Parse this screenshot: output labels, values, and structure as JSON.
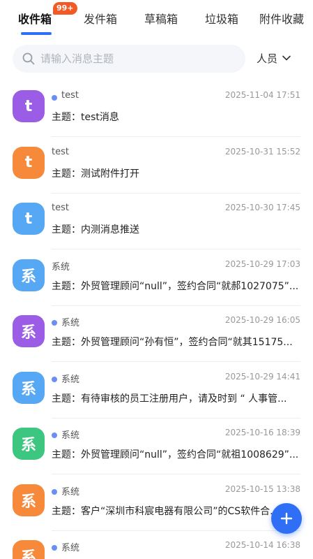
{
  "tabs": [
    {
      "label": "收件箱",
      "active": true
    },
    {
      "label": "发件箱",
      "active": false
    },
    {
      "label": "草稿箱",
      "active": false
    },
    {
      "label": "垃圾箱",
      "active": false
    },
    {
      "label": "附件收藏",
      "active": false
    }
  ],
  "badge": "99+",
  "search": {
    "placeholder": "请输入消息主题"
  },
  "filter": {
    "label": "人员"
  },
  "colors": {
    "accent": "#2f6ff5",
    "purple": "#9b5de5",
    "orange": "#f7893b",
    "blue": "#56a8f5",
    "green": "#3cc67f",
    "unread_dot": "#6a8ef7"
  },
  "messages": [
    {
      "avatar": "t",
      "color": "#9b5de5",
      "unread": true,
      "sender": "test",
      "time": "2025-11-04 17:51",
      "subject": "主题：test消息"
    },
    {
      "avatar": "t",
      "color": "#f7893b",
      "unread": false,
      "sender": "test",
      "time": "2025-10-31 15:52",
      "subject": "主题：测试附件打开"
    },
    {
      "avatar": "t",
      "color": "#56a8f5",
      "unread": false,
      "sender": "test",
      "time": "2025-10-30 17:45",
      "subject": "主题：内测消息推送"
    },
    {
      "avatar": "系",
      "color": "#56a8f5",
      "unread": false,
      "sender": "系统",
      "time": "2025-10-29 17:03",
      "subject": "主题：外贸管理顾问“null”，签约合同“就郝1027075”..."
    },
    {
      "avatar": "系",
      "color": "#9b5de5",
      "unread": true,
      "sender": "系统",
      "time": "2025-10-29 16:05",
      "subject": "主题：外贸管理顾问“孙有恒”，签约合同“就其15175..."
    },
    {
      "avatar": "系",
      "color": "#56a8f5",
      "unread": true,
      "sender": "系统",
      "time": "2025-10-29 14:41",
      "subject": "主题：有待审核的员工注册用户，请及时到 “ 人事管..."
    },
    {
      "avatar": "系",
      "color": "#3cc67f",
      "unread": true,
      "sender": "系统",
      "time": "2025-10-16 18:39",
      "subject": "主题：外贸管理顾问“null”，签约合同“就祖1008629”..."
    },
    {
      "avatar": "系",
      "color": "#f7893b",
      "unread": true,
      "sender": "系统",
      "time": "2025-10-15 13:38",
      "subject": "主题：客户“深圳市科宸电器有限公司”的CS软件合..."
    },
    {
      "avatar": "系",
      "color": "#f7893b",
      "unread": true,
      "sender": "系统",
      "time": "2025-10-14 16:38",
      "subject": ""
    }
  ]
}
